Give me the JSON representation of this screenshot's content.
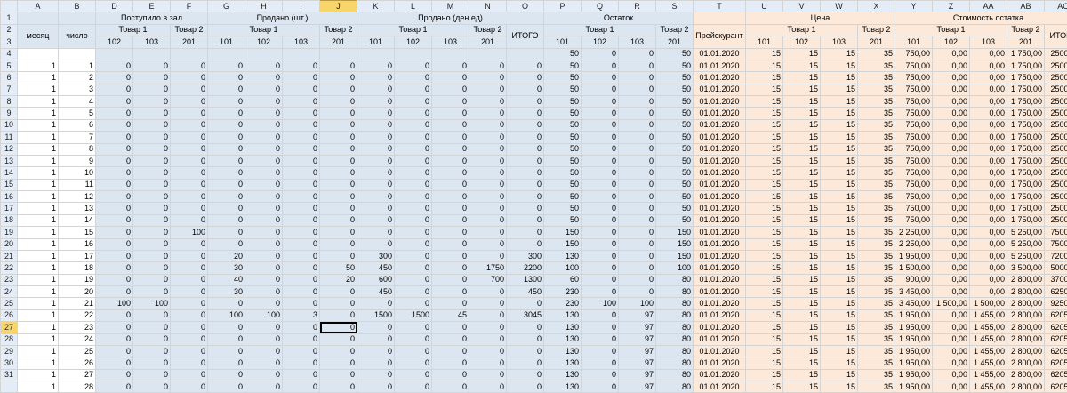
{
  "columns": [
    "A",
    "B",
    "D",
    "E",
    "F",
    "G",
    "H",
    "I",
    "J",
    "K",
    "L",
    "M",
    "N",
    "O",
    "P",
    "Q",
    "R",
    "S",
    "T",
    "U",
    "V",
    "W",
    "X",
    "Y",
    "Z",
    "AA",
    "AB",
    "AC"
  ],
  "selected_column": "J",
  "selected_row": "27",
  "row_numbers": [
    "1",
    "2",
    "3",
    "4",
    "5",
    "6",
    "7",
    "8",
    "9",
    "10",
    "11",
    "12",
    "13",
    "14",
    "15",
    "16",
    "17",
    "18",
    "19",
    "20",
    "21",
    "22",
    "23",
    "24",
    "25",
    "26",
    "27",
    "28",
    "29",
    "30",
    "31"
  ],
  "headers": {
    "month": "месяц",
    "day": "число",
    "received": "Поступило в зал",
    "sold_qty": "Продано (шт.)",
    "sold_money": "Продано (ден.ед)",
    "remainder": "Остаток",
    "pricelist": "Прейскурант",
    "price": "Цена",
    "remainder_value": "Стоимость остатка",
    "product1": "Товар 1",
    "product2": "Товар 2",
    "total": "ИТОГО",
    "c101": "101",
    "c102": "102",
    "c103": "103",
    "c201": "201"
  },
  "rows": [
    [
      "",
      "",
      "",
      "",
      "",
      "",
      "",
      "",
      "",
      "",
      "",
      "",
      "",
      "",
      "50",
      "0",
      "0",
      "50",
      "01.01.2020",
      "15",
      "15",
      "15",
      "35",
      "750,00",
      "0,00",
      "0,00",
      "1 750,00",
      "2500,00"
    ],
    [
      "1",
      "1",
      "0",
      "0",
      "0",
      "0",
      "0",
      "0",
      "0",
      "0",
      "0",
      "0",
      "0",
      "0",
      "50",
      "0",
      "0",
      "50",
      "01.01.2020",
      "15",
      "15",
      "15",
      "35",
      "750,00",
      "0,00",
      "0,00",
      "1 750,00",
      "2500,00"
    ],
    [
      "1",
      "2",
      "0",
      "0",
      "0",
      "0",
      "0",
      "0",
      "0",
      "0",
      "0",
      "0",
      "0",
      "0",
      "50",
      "0",
      "0",
      "50",
      "01.01.2020",
      "15",
      "15",
      "15",
      "35",
      "750,00",
      "0,00",
      "0,00",
      "1 750,00",
      "2500,00"
    ],
    [
      "1",
      "3",
      "0",
      "0",
      "0",
      "0",
      "0",
      "0",
      "0",
      "0",
      "0",
      "0",
      "0",
      "0",
      "50",
      "0",
      "0",
      "50",
      "01.01.2020",
      "15",
      "15",
      "15",
      "35",
      "750,00",
      "0,00",
      "0,00",
      "1 750,00",
      "2500,00"
    ],
    [
      "1",
      "4",
      "0",
      "0",
      "0",
      "0",
      "0",
      "0",
      "0",
      "0",
      "0",
      "0",
      "0",
      "0",
      "50",
      "0",
      "0",
      "50",
      "01.01.2020",
      "15",
      "15",
      "15",
      "35",
      "750,00",
      "0,00",
      "0,00",
      "1 750,00",
      "2500,00"
    ],
    [
      "1",
      "5",
      "0",
      "0",
      "0",
      "0",
      "0",
      "0",
      "0",
      "0",
      "0",
      "0",
      "0",
      "0",
      "50",
      "0",
      "0",
      "50",
      "01.01.2020",
      "15",
      "15",
      "15",
      "35",
      "750,00",
      "0,00",
      "0,00",
      "1 750,00",
      "2500,00"
    ],
    [
      "1",
      "6",
      "0",
      "0",
      "0",
      "0",
      "0",
      "0",
      "0",
      "0",
      "0",
      "0",
      "0",
      "0",
      "50",
      "0",
      "0",
      "50",
      "01.01.2020",
      "15",
      "15",
      "15",
      "35",
      "750,00",
      "0,00",
      "0,00",
      "1 750,00",
      "2500,00"
    ],
    [
      "1",
      "7",
      "0",
      "0",
      "0",
      "0",
      "0",
      "0",
      "0",
      "0",
      "0",
      "0",
      "0",
      "0",
      "50",
      "0",
      "0",
      "50",
      "01.01.2020",
      "15",
      "15",
      "15",
      "35",
      "750,00",
      "0,00",
      "0,00",
      "1 750,00",
      "2500,00"
    ],
    [
      "1",
      "8",
      "0",
      "0",
      "0",
      "0",
      "0",
      "0",
      "0",
      "0",
      "0",
      "0",
      "0",
      "0",
      "50",
      "0",
      "0",
      "50",
      "01.01.2020",
      "15",
      "15",
      "15",
      "35",
      "750,00",
      "0,00",
      "0,00",
      "1 750,00",
      "2500,00"
    ],
    [
      "1",
      "9",
      "0",
      "0",
      "0",
      "0",
      "0",
      "0",
      "0",
      "0",
      "0",
      "0",
      "0",
      "0",
      "50",
      "0",
      "0",
      "50",
      "01.01.2020",
      "15",
      "15",
      "15",
      "35",
      "750,00",
      "0,00",
      "0,00",
      "1 750,00",
      "2500,00"
    ],
    [
      "1",
      "10",
      "0",
      "0",
      "0",
      "0",
      "0",
      "0",
      "0",
      "0",
      "0",
      "0",
      "0",
      "0",
      "50",
      "0",
      "0",
      "50",
      "01.01.2020",
      "15",
      "15",
      "15",
      "35",
      "750,00",
      "0,00",
      "0,00",
      "1 750,00",
      "2500,00"
    ],
    [
      "1",
      "11",
      "0",
      "0",
      "0",
      "0",
      "0",
      "0",
      "0",
      "0",
      "0",
      "0",
      "0",
      "0",
      "50",
      "0",
      "0",
      "50",
      "01.01.2020",
      "15",
      "15",
      "15",
      "35",
      "750,00",
      "0,00",
      "0,00",
      "1 750,00",
      "2500,00"
    ],
    [
      "1",
      "12",
      "0",
      "0",
      "0",
      "0",
      "0",
      "0",
      "0",
      "0",
      "0",
      "0",
      "0",
      "0",
      "50",
      "0",
      "0",
      "50",
      "01.01.2020",
      "15",
      "15",
      "15",
      "35",
      "750,00",
      "0,00",
      "0,00",
      "1 750,00",
      "2500,00"
    ],
    [
      "1",
      "13",
      "0",
      "0",
      "0",
      "0",
      "0",
      "0",
      "0",
      "0",
      "0",
      "0",
      "0",
      "0",
      "50",
      "0",
      "0",
      "50",
      "01.01.2020",
      "15",
      "15",
      "15",
      "35",
      "750,00",
      "0,00",
      "0,00",
      "1 750,00",
      "2500,00"
    ],
    [
      "1",
      "14",
      "0",
      "0",
      "0",
      "0",
      "0",
      "0",
      "0",
      "0",
      "0",
      "0",
      "0",
      "0",
      "50",
      "0",
      "0",
      "50",
      "01.01.2020",
      "15",
      "15",
      "15",
      "35",
      "750,00",
      "0,00",
      "0,00",
      "1 750,00",
      "2500,00"
    ],
    [
      "1",
      "15",
      "0",
      "0",
      "100",
      "0",
      "0",
      "0",
      "0",
      "0",
      "0",
      "0",
      "0",
      "0",
      "150",
      "0",
      "0",
      "150",
      "01.01.2020",
      "15",
      "15",
      "15",
      "35",
      "2 250,00",
      "0,00",
      "0,00",
      "5 250,00",
      "7500,00"
    ],
    [
      "1",
      "16",
      "0",
      "0",
      "0",
      "0",
      "0",
      "0",
      "0",
      "0",
      "0",
      "0",
      "0",
      "0",
      "150",
      "0",
      "0",
      "150",
      "01.01.2020",
      "15",
      "15",
      "15",
      "35",
      "2 250,00",
      "0,00",
      "0,00",
      "5 250,00",
      "7500,00"
    ],
    [
      "1",
      "17",
      "0",
      "0",
      "0",
      "20",
      "0",
      "0",
      "0",
      "300",
      "0",
      "0",
      "0",
      "300",
      "130",
      "0",
      "0",
      "150",
      "01.01.2020",
      "15",
      "15",
      "15",
      "35",
      "1 950,00",
      "0,00",
      "0,00",
      "5 250,00",
      "7200,00"
    ],
    [
      "1",
      "18",
      "0",
      "0",
      "0",
      "30",
      "0",
      "0",
      "50",
      "450",
      "0",
      "0",
      "1750",
      "2200",
      "100",
      "0",
      "0",
      "100",
      "01.01.2020",
      "15",
      "15",
      "15",
      "35",
      "1 500,00",
      "0,00",
      "0,00",
      "3 500,00",
      "5000,00"
    ],
    [
      "1",
      "19",
      "0",
      "0",
      "0",
      "40",
      "0",
      "0",
      "20",
      "600",
      "0",
      "0",
      "700",
      "1300",
      "60",
      "0",
      "0",
      "80",
      "01.01.2020",
      "15",
      "15",
      "15",
      "35",
      "900,00",
      "0,00",
      "0,00",
      "2 800,00",
      "3700,00"
    ],
    [
      "1",
      "20",
      "0",
      "0",
      "0",
      "30",
      "0",
      "0",
      "0",
      "450",
      "0",
      "0",
      "0",
      "450",
      "230",
      "0",
      "0",
      "80",
      "01.01.2020",
      "15",
      "15",
      "15",
      "35",
      "3 450,00",
      "0,00",
      "0,00",
      "2 800,00",
      "6250,00"
    ],
    [
      "1",
      "21",
      "100",
      "100",
      "0",
      "0",
      "0",
      "0",
      "0",
      "0",
      "0",
      "0",
      "0",
      "0",
      "230",
      "100",
      "100",
      "80",
      "01.01.2020",
      "15",
      "15",
      "15",
      "35",
      "3 450,00",
      "1 500,00",
      "1 500,00",
      "2 800,00",
      "9250,00"
    ],
    [
      "1",
      "22",
      "0",
      "0",
      "0",
      "100",
      "100",
      "3",
      "0",
      "1500",
      "1500",
      "45",
      "0",
      "3045",
      "130",
      "0",
      "97",
      "80",
      "01.01.2020",
      "15",
      "15",
      "15",
      "35",
      "1 950,00",
      "0,00",
      "1 455,00",
      "2 800,00",
      "6205,00"
    ],
    [
      "1",
      "23",
      "0",
      "0",
      "0",
      "0",
      "0",
      "0",
      "0",
      "0",
      "0",
      "0",
      "0",
      "0",
      "130",
      "0",
      "97",
      "80",
      "01.01.2020",
      "15",
      "15",
      "15",
      "35",
      "1 950,00",
      "0,00",
      "1 455,00",
      "2 800,00",
      "6205,00"
    ],
    [
      "1",
      "24",
      "0",
      "0",
      "0",
      "0",
      "0",
      "0",
      "0",
      "0",
      "0",
      "0",
      "0",
      "0",
      "130",
      "0",
      "97",
      "80",
      "01.01.2020",
      "15",
      "15",
      "15",
      "35",
      "1 950,00",
      "0,00",
      "1 455,00",
      "2 800,00",
      "6205,00"
    ],
    [
      "1",
      "25",
      "0",
      "0",
      "0",
      "0",
      "0",
      "0",
      "0",
      "0",
      "0",
      "0",
      "0",
      "0",
      "130",
      "0",
      "97",
      "80",
      "01.01.2020",
      "15",
      "15",
      "15",
      "35",
      "1 950,00",
      "0,00",
      "1 455,00",
      "2 800,00",
      "6205,00"
    ],
    [
      "1",
      "26",
      "0",
      "0",
      "0",
      "0",
      "0",
      "0",
      "0",
      "0",
      "0",
      "0",
      "0",
      "0",
      "130",
      "0",
      "97",
      "80",
      "01.01.2020",
      "15",
      "15",
      "15",
      "35",
      "1 950,00",
      "0,00",
      "1 455,00",
      "2 800,00",
      "6205,00"
    ],
    [
      "1",
      "27",
      "0",
      "0",
      "0",
      "0",
      "0",
      "0",
      "0",
      "0",
      "0",
      "0",
      "0",
      "0",
      "130",
      "0",
      "97",
      "80",
      "01.01.2020",
      "15",
      "15",
      "15",
      "35",
      "1 950,00",
      "0,00",
      "1 455,00",
      "2 800,00",
      "6205,00"
    ],
    [
      "1",
      "28",
      "0",
      "0",
      "0",
      "0",
      "0",
      "0",
      "0",
      "0",
      "0",
      "0",
      "0",
      "0",
      "130",
      "0",
      "97",
      "80",
      "01.01.2020",
      "15",
      "15",
      "15",
      "35",
      "1 950,00",
      "0,00",
      "1 455,00",
      "2 800,00",
      "6205,00"
    ]
  ]
}
